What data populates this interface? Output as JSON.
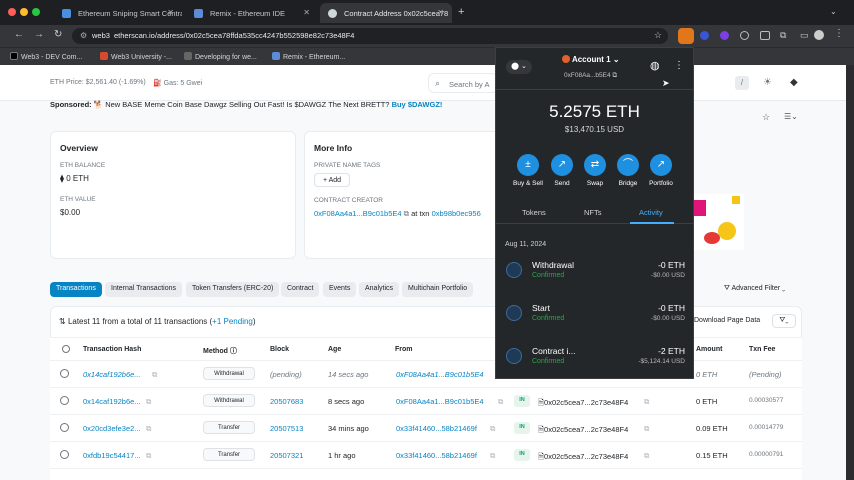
{
  "browser": {
    "tabs": [
      {
        "title": "Ethereum Sniping Smart Contract",
        "icon_color": "#4a90e2"
      },
      {
        "title": "Remix - Ethereum IDE",
        "icon_color": "#5e8bd6"
      },
      {
        "title": "Contract Address 0x02c5cea78",
        "icon_color": "#cfd8dc"
      }
    ],
    "url": "etherscan.io/address/0x02c5cea78ffda535cc4247b552598e82c73e48F4",
    "url_prefix": "web3",
    "bookmarks": [
      "Web3 - DEV Com...",
      "Web3 University -...",
      "Developing for we...",
      "Remix - Ethereum..."
    ]
  },
  "etherscan": {
    "eth_price": "ETH Price: $2,561.40 (-1.69%)",
    "gas": "Gas: 5 Gwei",
    "search_placeholder": "Search by A",
    "sponsored_label": "Sponsored:",
    "sponsored_text": "New BASE Meme Coin Base Dawgz Selling Out Fast! Is $DAWGZ The Next BRETT?",
    "sponsored_link": "Buy $DAWGZ!",
    "overview": {
      "title": "Overview",
      "balance_label": "ETH BALANCE",
      "balance_value": "0 ETH",
      "value_label": "ETH VALUE",
      "value_value": "$0.00"
    },
    "more_info": {
      "title": "More Info",
      "private_tags_label": "PRIVATE NAME TAGS",
      "add_button": "+ Add",
      "creator_label": "CONTRACT CREATOR",
      "creator_address": "0xF08Aa4a1...B9c01b5E4",
      "creator_at": "at txn",
      "creator_txn": "0xb98b0ec956"
    },
    "tabs": [
      "Transactions",
      "Internal Transactions",
      "Token Transfers (ERC-20)",
      "Contract",
      "Events",
      "Analytics",
      "Multichain Portfolio"
    ],
    "advanced_filter": "Advanced Filter",
    "summary_prefix": "Latest 11 from a total of 11 transactions (",
    "summary_pending": "+1 Pending",
    "summary_suffix": ")",
    "download": "Download Page Data",
    "columns": [
      "Transaction Hash",
      "Method",
      "Block",
      "Age",
      "From",
      "To",
      "Amount",
      "Txn Fee"
    ],
    "rows": [
      {
        "hash": "0x14caf192b6e...",
        "method": "Withdrawal",
        "block": "(pending)",
        "age": "14 secs ago",
        "from": "0xF08Aa4a1...B9c01b5E4",
        "to": "",
        "amount": "0 ETH",
        "fee": "(Pending)",
        "pending": true
      },
      {
        "hash": "0x14caf192b6e...",
        "method": "Withdrawal",
        "block": "20507683",
        "age": "8 secs ago",
        "from": "0xF08Aa4a1...B9c01b5E4",
        "to": "0x02c5cea7...2c73e48F4",
        "amount": "0 ETH",
        "fee": "0.00030577",
        "pending": false
      },
      {
        "hash": "0x20cd3efe3e2...",
        "method": "Transfer",
        "block": "20507513",
        "age": "34 mins ago",
        "from": "0x33f41460...58b21469f",
        "to": "0x02c5cea7...2c73e48F4",
        "amount": "0.09 ETH",
        "fee": "0.00014779",
        "pending": false
      },
      {
        "hash": "0xfdb19c54417...",
        "method": "Transfer",
        "block": "20507321",
        "age": "1 hr ago",
        "from": "0x33f41460...58b21469f",
        "to": "0x02c5cea7...2c73e48F4",
        "amount": "0.15 ETH",
        "fee": "0.00000791",
        "pending": false
      }
    ],
    "in_badge": "IN"
  },
  "metamask": {
    "account_name": "Account 1",
    "account_address": "0xF08Aa...b5E4",
    "balance_eth": "5.2575 ETH",
    "balance_usd": "$13,470.15 USD",
    "actions": [
      "Buy & Sell",
      "Send",
      "Swap",
      "Bridge",
      "Portfolio"
    ],
    "tabs": [
      "Tokens",
      "NFTs",
      "Activity"
    ],
    "date": "Aug 11, 2024",
    "activity": [
      {
        "title": "Withdrawal",
        "status": "Confirmed",
        "amount": "-0 ETH",
        "usd": "-$0.00 USD"
      },
      {
        "title": "Start",
        "status": "Confirmed",
        "amount": "-0 ETH",
        "usd": "-$0.00 USD"
      },
      {
        "title": "Contract i...",
        "status": "Confirmed",
        "amount": "-2 ETH",
        "usd": "-$5,124.14 USD"
      }
    ]
  }
}
